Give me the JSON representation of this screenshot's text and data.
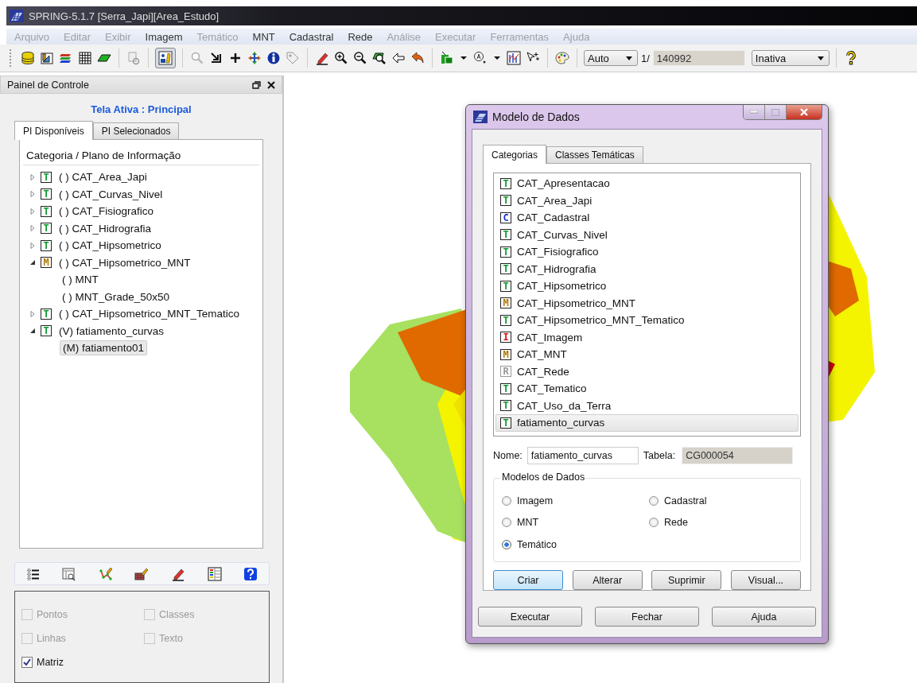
{
  "window": {
    "title": "SPRING-5.1.7 [Serra_Japi][Area_Estudo]"
  },
  "menu": [
    {
      "label": "Arquivo",
      "disabled": true
    },
    {
      "label": "Editar",
      "disabled": true
    },
    {
      "label": "Exibir",
      "disabled": true
    },
    {
      "label": "Imagem",
      "disabled": false
    },
    {
      "label": "Temático",
      "disabled": true
    },
    {
      "label": "MNT",
      "disabled": false
    },
    {
      "label": "Cadastral",
      "disabled": false
    },
    {
      "label": "Rede",
      "disabled": false
    },
    {
      "label": "Análise",
      "disabled": true
    },
    {
      "label": "Executar",
      "disabled": true
    },
    {
      "label": "Ferramentas",
      "disabled": true
    },
    {
      "label": "Ajuda",
      "disabled": true
    }
  ],
  "toolbar": {
    "zoom_mode": "Auto",
    "scale_prefix": "1/",
    "scale": "140992",
    "status": "Inativa"
  },
  "control_panel": {
    "title": "Painel de Controle",
    "active_screen": "Tela Ativa : Principal",
    "tabs": [
      {
        "label": "PI Disponíveis",
        "selected": true
      },
      {
        "label": "PI Selecionados",
        "selected": false
      }
    ],
    "tree_header": "Categoria / Plano de Informação",
    "tree": [
      {
        "label": "( ) CAT_Area_Japi",
        "kind": "thematic",
        "letter": "T",
        "expanded": false,
        "selected": false
      },
      {
        "label": "( ) CAT_Curvas_Nivel",
        "kind": "thematic",
        "letter": "T",
        "expanded": false,
        "selected": false
      },
      {
        "label": "( ) CAT_Fisiografico",
        "kind": "thematic",
        "letter": "T",
        "expanded": false,
        "selected": false
      },
      {
        "label": "( ) CAT_Hidrografia",
        "kind": "thematic",
        "letter": "T",
        "expanded": false,
        "selected": false
      },
      {
        "label": "( ) CAT_Hipsometrico",
        "kind": "thematic",
        "letter": "T",
        "expanded": false,
        "selected": false
      },
      {
        "label": "( ) CAT_Hipsometrico_MNT",
        "kind": "mnt",
        "letter": "M",
        "expanded": true,
        "selected": false,
        "children": [
          {
            "label": "( ) MNT",
            "selected": false
          },
          {
            "label": "( ) MNT_Grade_50x50",
            "selected": false
          }
        ]
      },
      {
        "label": "( ) CAT_Hipsometrico_MNT_Tematico",
        "kind": "thematic",
        "letter": "T",
        "expanded": false,
        "selected": false
      },
      {
        "label": "(V) fatiamento_curvas",
        "kind": "thematic",
        "letter": "T",
        "expanded": true,
        "selected": false,
        "children": [
          {
            "label": "(M) fatiamento01",
            "selected": true
          }
        ]
      }
    ],
    "layers": [
      {
        "label": "Pontos",
        "checked": false,
        "disabled": true
      },
      {
        "label": "Classes",
        "checked": false,
        "disabled": true
      },
      {
        "label": "Linhas",
        "checked": false,
        "disabled": true
      },
      {
        "label": "Texto",
        "checked": false,
        "disabled": true
      },
      {
        "label": "Matriz",
        "checked": true,
        "disabled": false
      }
    ]
  },
  "dialog": {
    "title": "Modelo de Dados",
    "tabs": [
      {
        "label": "Categorias",
        "selected": true
      },
      {
        "label": "Classes Temáticas",
        "selected": false
      }
    ],
    "categories": [
      {
        "label": "CAT_Apresentacao",
        "kind": "thematic",
        "letter": "T",
        "selected": false
      },
      {
        "label": "CAT_Area_Japi",
        "kind": "thematic",
        "letter": "T",
        "selected": false
      },
      {
        "label": "CAT_Cadastral",
        "kind": "cadastral",
        "letter": "C",
        "selected": false
      },
      {
        "label": "CAT_Curvas_Nivel",
        "kind": "thematic",
        "letter": "T",
        "selected": false
      },
      {
        "label": "CAT_Fisiografico",
        "kind": "thematic",
        "letter": "T",
        "selected": false
      },
      {
        "label": "CAT_Hidrografia",
        "kind": "thematic",
        "letter": "T",
        "selected": false
      },
      {
        "label": "CAT_Hipsometrico",
        "kind": "thematic",
        "letter": "T",
        "selected": false
      },
      {
        "label": "CAT_Hipsometrico_MNT",
        "kind": "mnt",
        "letter": "M",
        "selected": false
      },
      {
        "label": "CAT_Hipsometrico_MNT_Tematico",
        "kind": "thematic",
        "letter": "T",
        "selected": false
      },
      {
        "label": "CAT_Imagem",
        "letter": "I",
        "selected": false
      },
      {
        "label": "CAT_MNT",
        "kind": "mnt",
        "letter": "M",
        "selected": false
      },
      {
        "label": "CAT_Rede",
        "kind": "network",
        "letter": "R",
        "selected": false
      },
      {
        "label": "CAT_Tematico",
        "kind": "thematic",
        "letter": "T",
        "selected": false
      },
      {
        "label": "CAT_Uso_da_Terra",
        "kind": "thematic",
        "letter": "T",
        "selected": false
      },
      {
        "label": "fatiamento_curvas",
        "kind": "thematic",
        "letter": "T",
        "selected": true
      }
    ],
    "name_label": "Nome:",
    "name": "fatiamento_curvas",
    "table_label": "Tabela:",
    "table": "CG000054",
    "models_title": "Modelos de Dados",
    "models": [
      {
        "label": "Imagem",
        "selected": false
      },
      {
        "label": "Cadastral",
        "selected": false
      },
      {
        "label": "MNT",
        "selected": false
      },
      {
        "label": "Rede",
        "selected": false
      },
      {
        "label": "Temático",
        "selected": true
      }
    ],
    "actions": [
      {
        "label": "Criar",
        "default": true
      },
      {
        "label": "Alterar",
        "default": false
      },
      {
        "label": "Suprimir",
        "default": false
      },
      {
        "label": "Visual...",
        "default": false
      }
    ],
    "footer": [
      "Executar",
      "Fechar",
      "Ajuda"
    ]
  }
}
